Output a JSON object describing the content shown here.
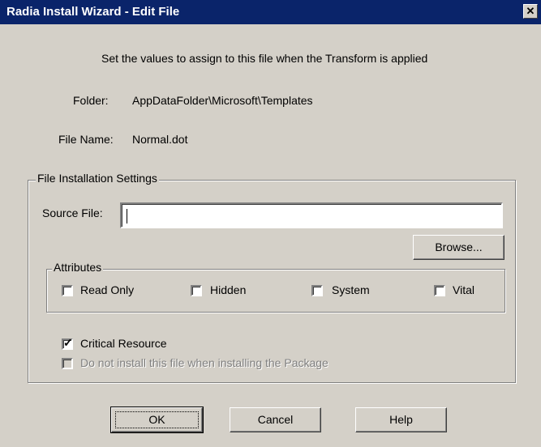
{
  "window": {
    "title": "Radia Install Wizard - Edit File",
    "close_glyph": "✕"
  },
  "intro": "Set the values to assign to this file when the Transform is applied",
  "folder": {
    "label": "Folder:",
    "value": "AppDataFolder\\Microsoft\\Templates"
  },
  "file_name": {
    "label": "File Name:",
    "value": "Normal.dot"
  },
  "settings": {
    "legend": "File Installation Settings",
    "source_file": {
      "label": "Source File:",
      "value": ""
    },
    "browse_label": "Browse...",
    "attributes": {
      "legend": "Attributes",
      "items": [
        {
          "label": "Read Only",
          "checked": false
        },
        {
          "label": "Hidden",
          "checked": false
        },
        {
          "label": "System",
          "checked": false
        },
        {
          "label": "Vital",
          "checked": false
        }
      ]
    },
    "critical_resource": {
      "label": "Critical Resource",
      "checked": true
    },
    "do_not_install": {
      "label": "Do not install this file when installing the Package",
      "checked": false,
      "disabled": true
    }
  },
  "buttons": {
    "ok": "OK",
    "cancel": "Cancel",
    "help": "Help"
  }
}
